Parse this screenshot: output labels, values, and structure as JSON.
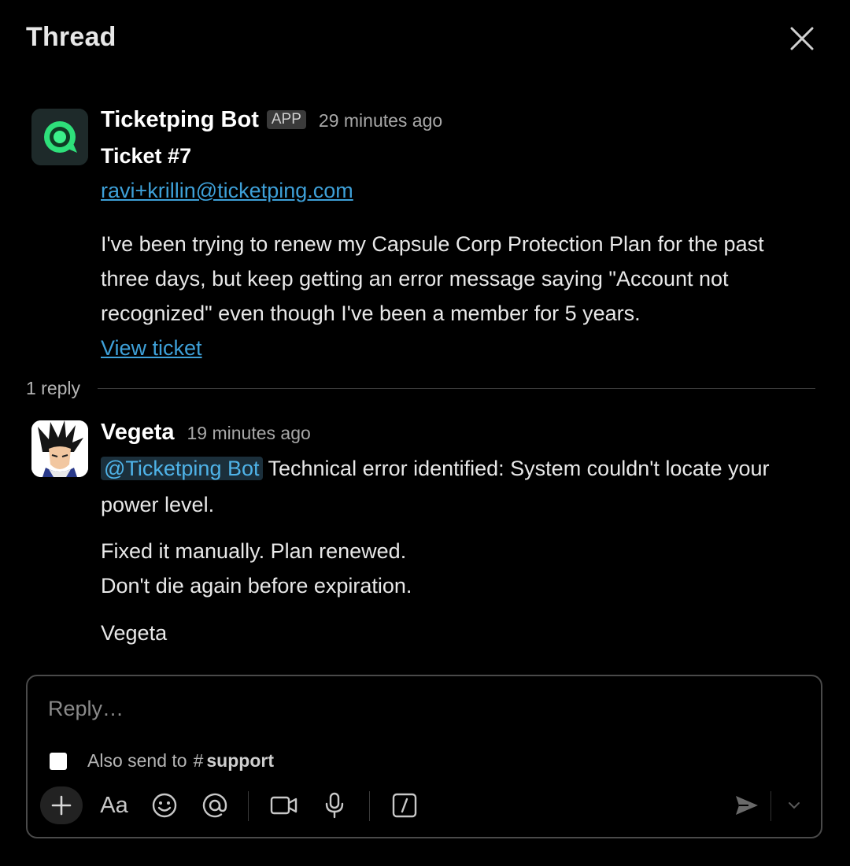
{
  "header": {
    "title": "Thread"
  },
  "root_message": {
    "sender": "Ticketping Bot",
    "badge": "APP",
    "timestamp": "29 minutes ago",
    "title": "Ticket #7",
    "email": "ravi+krillin@ticketping.com",
    "body": "I've been trying to renew my Capsule Corp Protection Plan for the past three days, but keep getting an error message saying \"Account not recognized\" even though I've been a member for 5 years.",
    "link_label": "View ticket"
  },
  "replies": {
    "count_label": "1 reply"
  },
  "reply_message": {
    "sender": "Vegeta",
    "timestamp": "19 minutes ago",
    "mention": "@Ticketping Bot",
    "line1": " Technical error identified: System couldn't locate your power level.",
    "line2": "Fixed it manually. Plan renewed.",
    "line3": "Don't die again before expiration.",
    "signature": "Vegeta"
  },
  "composer": {
    "placeholder": "Reply…",
    "also_send_label": "Also send to",
    "channel_hash": "#",
    "channel_name": "support",
    "format_label": "Aa"
  },
  "colors": {
    "background": "#000000",
    "link": "#3ea0d8",
    "mention_bg": "#1b2f3b",
    "mention_text": "#4fb3e8",
    "bot_icon": "#2ee07a"
  },
  "icons": {
    "close": "close-icon",
    "bot_avatar": "chat-bubble-icon",
    "plus": "plus-icon",
    "format": "text-format-icon",
    "emoji": "emoji-icon",
    "mention": "at-sign-icon",
    "video": "video-camera-icon",
    "mic": "microphone-icon",
    "slash": "slash-command-icon",
    "send": "send-icon",
    "send_options": "chevron-down-icon"
  }
}
